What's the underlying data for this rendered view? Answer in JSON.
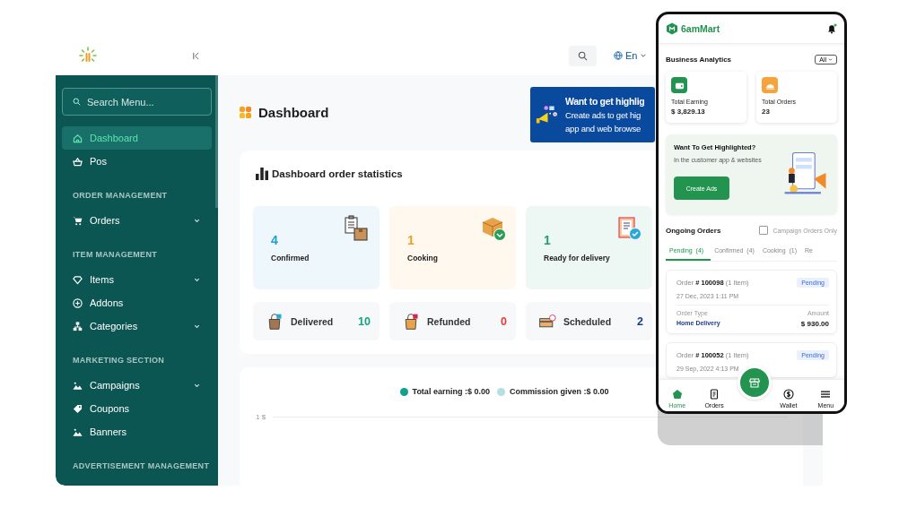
{
  "header": {
    "language": "En"
  },
  "sidebar": {
    "search_placeholder": "Search Menu...",
    "groups": [
      {
        "items": [
          {
            "label": "Dashboard",
            "selected": true,
            "expandable": false
          },
          {
            "label": "Pos",
            "selected": false,
            "expandable": false
          }
        ]
      },
      {
        "heading": "ORDER MANAGEMENT",
        "items": [
          {
            "label": "Orders",
            "selected": false,
            "expandable": true
          }
        ]
      },
      {
        "heading": "ITEM MANAGEMENT",
        "items": [
          {
            "label": "Items",
            "selected": false,
            "expandable": true
          },
          {
            "label": "Addons",
            "selected": false,
            "expandable": false
          },
          {
            "label": "Categories",
            "selected": false,
            "expandable": true
          }
        ]
      },
      {
        "heading": "MARKETING SECTION",
        "items": [
          {
            "label": "Campaigns",
            "selected": false,
            "expandable": true
          },
          {
            "label": "Coupons",
            "selected": false,
            "expandable": false
          },
          {
            "label": "Banners",
            "selected": false,
            "expandable": false
          }
        ]
      },
      {
        "heading": "ADVERTISEMENT MANAGEMENT"
      }
    ]
  },
  "page": {
    "title": "Dashboard",
    "promo": {
      "title": "Want to get highlig",
      "lines": [
        "Create ads to get hig",
        "app and web browse"
      ]
    }
  },
  "order_statistics": {
    "title": "Dashboard order statistics",
    "status_cards": [
      {
        "count": "4",
        "label": "Confirmed",
        "color": "#1e9fd4"
      },
      {
        "count": "1",
        "label": "Cooking",
        "color": "#f0a020"
      },
      {
        "count": "1",
        "label": "Ready for delivery",
        "color": "#1f9e6e"
      }
    ],
    "summary": [
      {
        "label": "Delivered",
        "count": "10",
        "color": "#14a37f"
      },
      {
        "label": "Refunded",
        "count": "0",
        "color": "#e53935"
      },
      {
        "label": "Scheduled",
        "count": "2",
        "color": "#1a3e8c"
      }
    ]
  },
  "earnings_chart": {
    "legend": [
      {
        "label": "Total earning :$ 0.00",
        "color": "#10a090"
      },
      {
        "label": "Commission given :$ 0.00",
        "color": "#b3e0de"
      }
    ],
    "y_tick": "1 $"
  },
  "phone": {
    "brand": "6amMart",
    "analytics": {
      "title": "Business Analytics",
      "filter": "All",
      "cards": [
        {
          "label": "Total Earning",
          "value": "$ 3,829.13",
          "color": "#23944f"
        },
        {
          "label": "Total Orders",
          "value": "23",
          "color": "#f5a33a"
        }
      ]
    },
    "ad": {
      "title": "Want To Get Highlighted?",
      "text": "In the customer app & websites",
      "button": "Create Ads"
    },
    "orders": {
      "title": "Ongoing Orders",
      "campaign_filter": {
        "label": "Campaign Orders Only",
        "checked": false
      },
      "tabs": [
        {
          "label": "Pending  (4)",
          "selected": true
        },
        {
          "label": "Confirmed  (4)",
          "selected": false
        },
        {
          "label": "Cooking  (1)",
          "selected": false
        },
        {
          "label": "Re",
          "selected": false
        }
      ],
      "list": [
        {
          "title": "Order **# 100098** (1 Item)",
          "status": "Pending",
          "date": "27 Dec, 2023 1:11 PM",
          "type_label": "Order Type",
          "type": "Home Delivery",
          "amount_label": "Amount",
          "amount": "$ 930.00"
        },
        {
          "title": "Order **# 100052** (1 Item)",
          "status": "Pending",
          "date": "29 Sep, 2022 4:13 PM"
        }
      ]
    },
    "nav": [
      {
        "label": "Home",
        "selected": true
      },
      {
        "label": "Orders",
        "selected": false
      },
      {
        "label": "Wallet",
        "selected": false
      },
      {
        "label": "Menu",
        "selected": false
      }
    ]
  }
}
